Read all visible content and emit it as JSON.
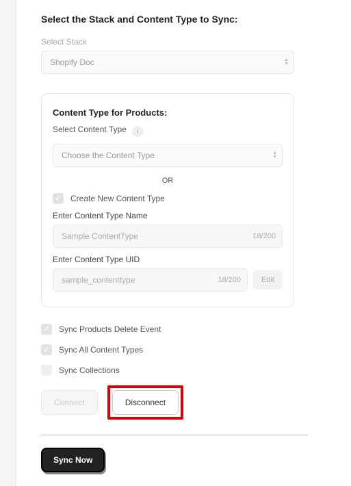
{
  "header": {
    "title": "Select the Stack and Content Type to Sync:"
  },
  "stack": {
    "label": "Select Stack",
    "value": "Shopify Doc"
  },
  "contentCard": {
    "title": "Content Type for Products:",
    "selectLabel": "Select Content Type",
    "dropdownValue": "Choose the Content Type",
    "or": "OR",
    "createCheckbox": {
      "label": "Create New Content Type",
      "checked": true
    },
    "nameField": {
      "label": "Enter Content Type Name",
      "value": "Sample ContentType",
      "count": "18/200"
    },
    "uidField": {
      "label": "Enter Content Type UID",
      "value": "sample_contenttype",
      "count": "18/200",
      "editButton": "Edit"
    }
  },
  "options": {
    "syncDelete": {
      "label": "Sync Products Delete Event",
      "checked": true
    },
    "syncAll": {
      "label": "Sync All Content Types",
      "checked": true
    },
    "syncCollections": {
      "label": "Sync Collections",
      "checked": false
    }
  },
  "buttons": {
    "connect": "Connect",
    "disconnect": "Disconnect",
    "syncNow": "Sync Now"
  }
}
